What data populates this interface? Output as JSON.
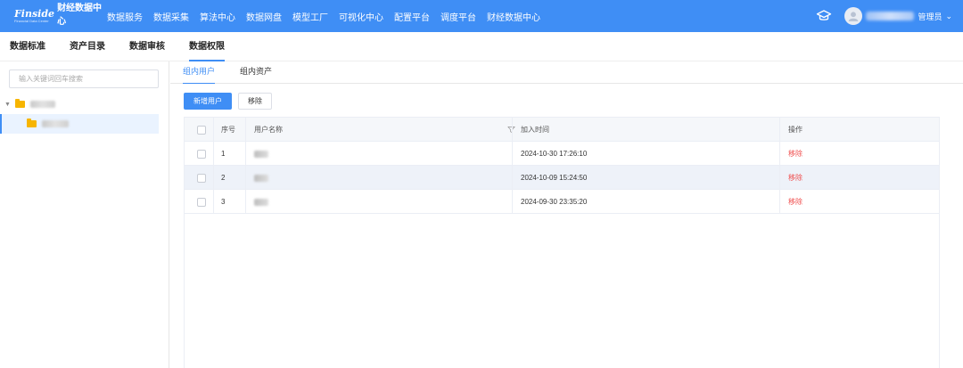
{
  "header": {
    "brand_en": "Finside",
    "brand_sub": "Financial Data Center",
    "brand_name": "财经数据中心",
    "nav": [
      "数据服务",
      "数据采集",
      "算法中心",
      "数据网盘",
      "模型工厂",
      "可视化中心",
      "配置平台",
      "调度平台",
      "财经数据中心"
    ],
    "user_role": "管理员"
  },
  "subtabs": [
    "数据标准",
    "资产目录",
    "数据审核",
    "数据权限"
  ],
  "left": {
    "search_placeholder": "输入关键词回车搜索"
  },
  "main": {
    "tabs": [
      "组内用户",
      "组内资产"
    ],
    "add_button": "新增用户",
    "remove_button": "移除",
    "table": {
      "columns": [
        "序号",
        "用户名称",
        "加入时间",
        "操作"
      ],
      "rows": [
        {
          "index": "1",
          "time": "2024-10-30 17:26:10",
          "action": "移除"
        },
        {
          "index": "2",
          "time": "2024-10-09 15:24:50",
          "action": "移除"
        },
        {
          "index": "3",
          "time": "2024-09-30 23:35:20",
          "action": "移除"
        }
      ]
    }
  },
  "colors": {
    "primary": "#3f8ef5",
    "danger": "#f05050",
    "folder": "#f7b500"
  }
}
